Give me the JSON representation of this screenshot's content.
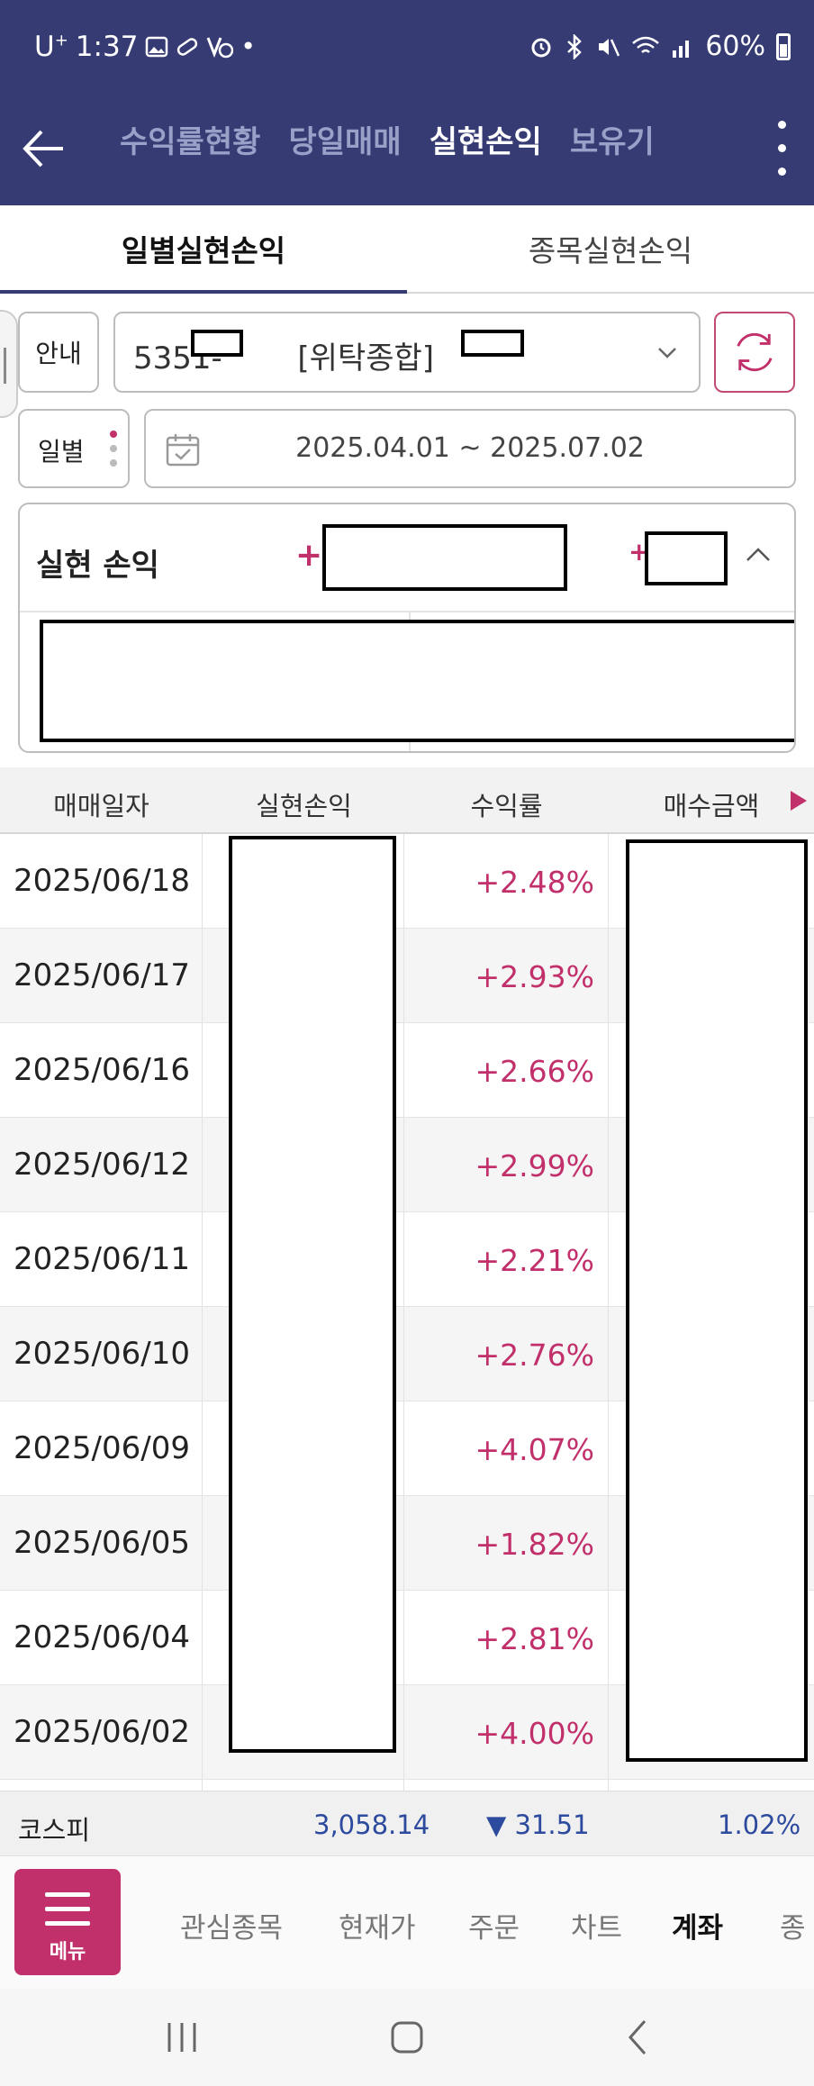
{
  "status_bar": {
    "carrier": "U",
    "carrier_sup": "+",
    "time": "1:37",
    "battery": "60%"
  },
  "header": {
    "tabs": [
      {
        "label": "수익률현황"
      },
      {
        "label": "당일매매"
      },
      {
        "label": "실현손익"
      },
      {
        "label": "보유기"
      }
    ],
    "active_tab": "실현손익"
  },
  "sub_tabs": [
    {
      "label": "일별실현손익"
    },
    {
      "label": "종목실현손익"
    }
  ],
  "controls": {
    "guide_label": "안내",
    "account_prefix": "5351-",
    "account_type": "[위탁종합]",
    "period_label": "일별",
    "date_range": "2025.04.01 ~ 2025.07.02"
  },
  "summary": {
    "title": "실현 손익",
    "plus_sign": "+"
  },
  "table": {
    "headers": [
      "매매일자",
      "실현손익",
      "수익률",
      "매수금액"
    ],
    "rows": [
      {
        "date": "2025/06/18",
        "rate": "+2.48%"
      },
      {
        "date": "2025/06/17",
        "rate": "+2.93%"
      },
      {
        "date": "2025/06/16",
        "rate": "+2.66%"
      },
      {
        "date": "2025/06/12",
        "rate": "+2.99%"
      },
      {
        "date": "2025/06/11",
        "rate": "+2.21%"
      },
      {
        "date": "2025/06/10",
        "rate": "+2.76%"
      },
      {
        "date": "2025/06/09",
        "rate": "+4.07%"
      },
      {
        "date": "2025/06/05",
        "rate": "+1.82%"
      },
      {
        "date": "2025/06/04",
        "rate": "+2.81%"
      },
      {
        "date": "2025/06/02",
        "rate": "+4.00%"
      }
    ]
  },
  "ticker": {
    "name": "코스피",
    "price": "3,058.14",
    "change": "▼ 31.51",
    "percent": "1.02%"
  },
  "bottom_menu": {
    "menu_label": "메뉴",
    "items": [
      "관심종목",
      "현재가",
      "주문",
      "차트",
      "계좌",
      "종"
    ],
    "active_item": "계좌"
  },
  "colors": {
    "header_bg": "#363b73",
    "accent_pink": "#c1306b",
    "ticker_blue": "#2c4a9e"
  }
}
